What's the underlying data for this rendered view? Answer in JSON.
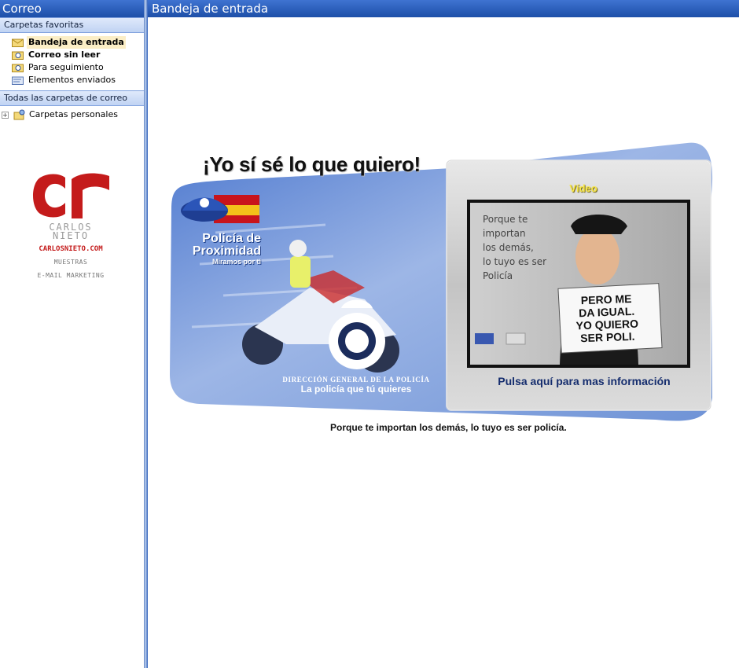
{
  "nav": {
    "title": "Correo",
    "favorites_header": "Carpetas favoritas",
    "favorites": [
      {
        "label": "Bandeja de entrada",
        "icon": "inbox-folder-icon",
        "selected": true
      },
      {
        "label": "Correo sin leer",
        "icon": "search-folder-icon",
        "bold": true
      },
      {
        "label": "Para seguimiento",
        "icon": "search-folder-icon"
      },
      {
        "label": "Elementos enviados",
        "icon": "sent-folder-icon"
      }
    ],
    "all_folders_header": "Todas las carpetas de correo",
    "tree_root": {
      "label": "Carpetas personales",
      "icon": "personal-folders-icon",
      "expander": "+"
    },
    "logo": {
      "mark": "cr",
      "name_line1": "CARLOS",
      "name_line2": "NIETO",
      "url": "CARLOSNIETO.COM",
      "tagline_line1": "MUESTRAS",
      "tagline_line2": "E-MAIL MARKETING"
    }
  },
  "main": {
    "title": "Bandeja de entrada"
  },
  "banner": {
    "headline": "¡Yo sí sé lo que quiero!",
    "brand_line1": "Policía de",
    "brand_line2": "Proximidad",
    "brand_tagline": "Miramos por ti",
    "org_name": "DIRECCIÓN GENERAL DE LA POLICÍA",
    "org_slogan": "La policía que tú quieres",
    "video_label": "Vídeo",
    "video_quote": [
      "Porque te",
      "importan",
      "los demás,",
      "lo tuyo es ser",
      "Policía"
    ],
    "sign_text": [
      "PERO ME",
      "DA IGUAL.",
      "YO QUIERO",
      "SER POLI."
    ],
    "cta": "Pulsa aquí para mas información",
    "caption": "Porque te importan los demás, lo tuyo es ser policía."
  },
  "colors": {
    "header_blue": "#1d4fa8",
    "banner_blue": "#7a9bd8",
    "logo_red": "#c41b1b",
    "video_label_yellow": "#f7e64a",
    "cta_navy": "#152d6e"
  }
}
